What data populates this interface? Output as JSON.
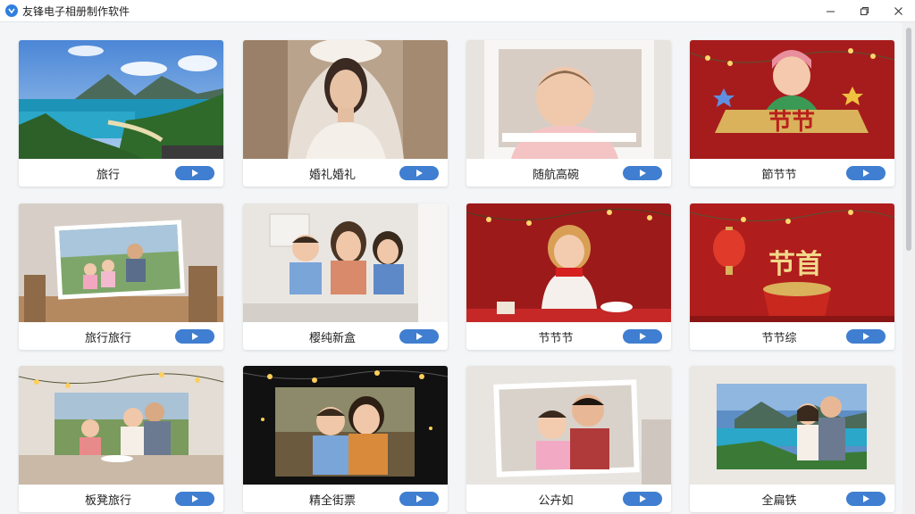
{
  "window": {
    "title": "友锋电子相册制作软件",
    "icon": "app-logo-icon",
    "controls": [
      "minimize-icon",
      "maximize-icon",
      "close-icon"
    ]
  },
  "templates": [
    {
      "label": "旅行",
      "scene": "landscape-lake"
    },
    {
      "label": "婚礼婚礼",
      "scene": "bride-portrait"
    },
    {
      "label": "随航高碗",
      "scene": "baby-portrait"
    },
    {
      "label": "節节节",
      "scene": "holiday-girl-banner"
    },
    {
      "label": "旅行旅行",
      "scene": "family-photo-frame"
    },
    {
      "label": "樱纯新盒",
      "scene": "family-dining"
    },
    {
      "label": "节节节",
      "scene": "christmas-girl"
    },
    {
      "label": "节节综",
      "scene": "festival-lantern"
    },
    {
      "label": "板凳旅行",
      "scene": "family-string-lights"
    },
    {
      "label": "精全街票",
      "scene": "mother-son-lights"
    },
    {
      "label": "公卉如",
      "scene": "father-daughter-frame"
    },
    {
      "label": "全扁铁",
      "scene": "couple-landscape-frame"
    }
  ],
  "play_icon": "play-icon"
}
